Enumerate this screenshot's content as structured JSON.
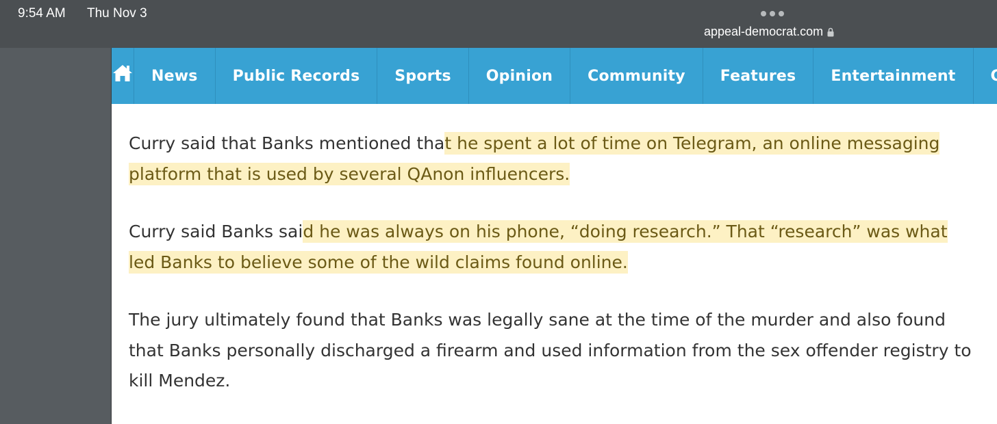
{
  "status_bar": {
    "time": "9:54 AM",
    "date": "Thu Nov 3",
    "url": "appeal-democrat.com"
  },
  "nav": {
    "home_icon": "home-icon",
    "items": [
      "News",
      "Public Records",
      "Sports",
      "Opinion",
      "Community",
      "Features",
      "Entertainment",
      "C"
    ]
  },
  "article": {
    "p1_plain": "Curry said that Banks mentioned tha",
    "p1_highlight": "t he spent a lot of time on Telegram, an online messaging platform that is used by several QAnon influencers.",
    "p2_plain": "Curry said Banks sai",
    "p2_highlight": "d he was always on his phone, “doing research.” That “research” was what led Banks to believe some of the wild claims found online.",
    "p3": "The jury ultimately found that Banks was legally sane at the time of the murder and also found that Banks personally discharged a firearm and used information from the sex offender registry to kill Mendez."
  },
  "colors": {
    "nav_background": "#38a2d3",
    "highlight": "#fdf1c4",
    "status_bar": "#4b4f52"
  }
}
